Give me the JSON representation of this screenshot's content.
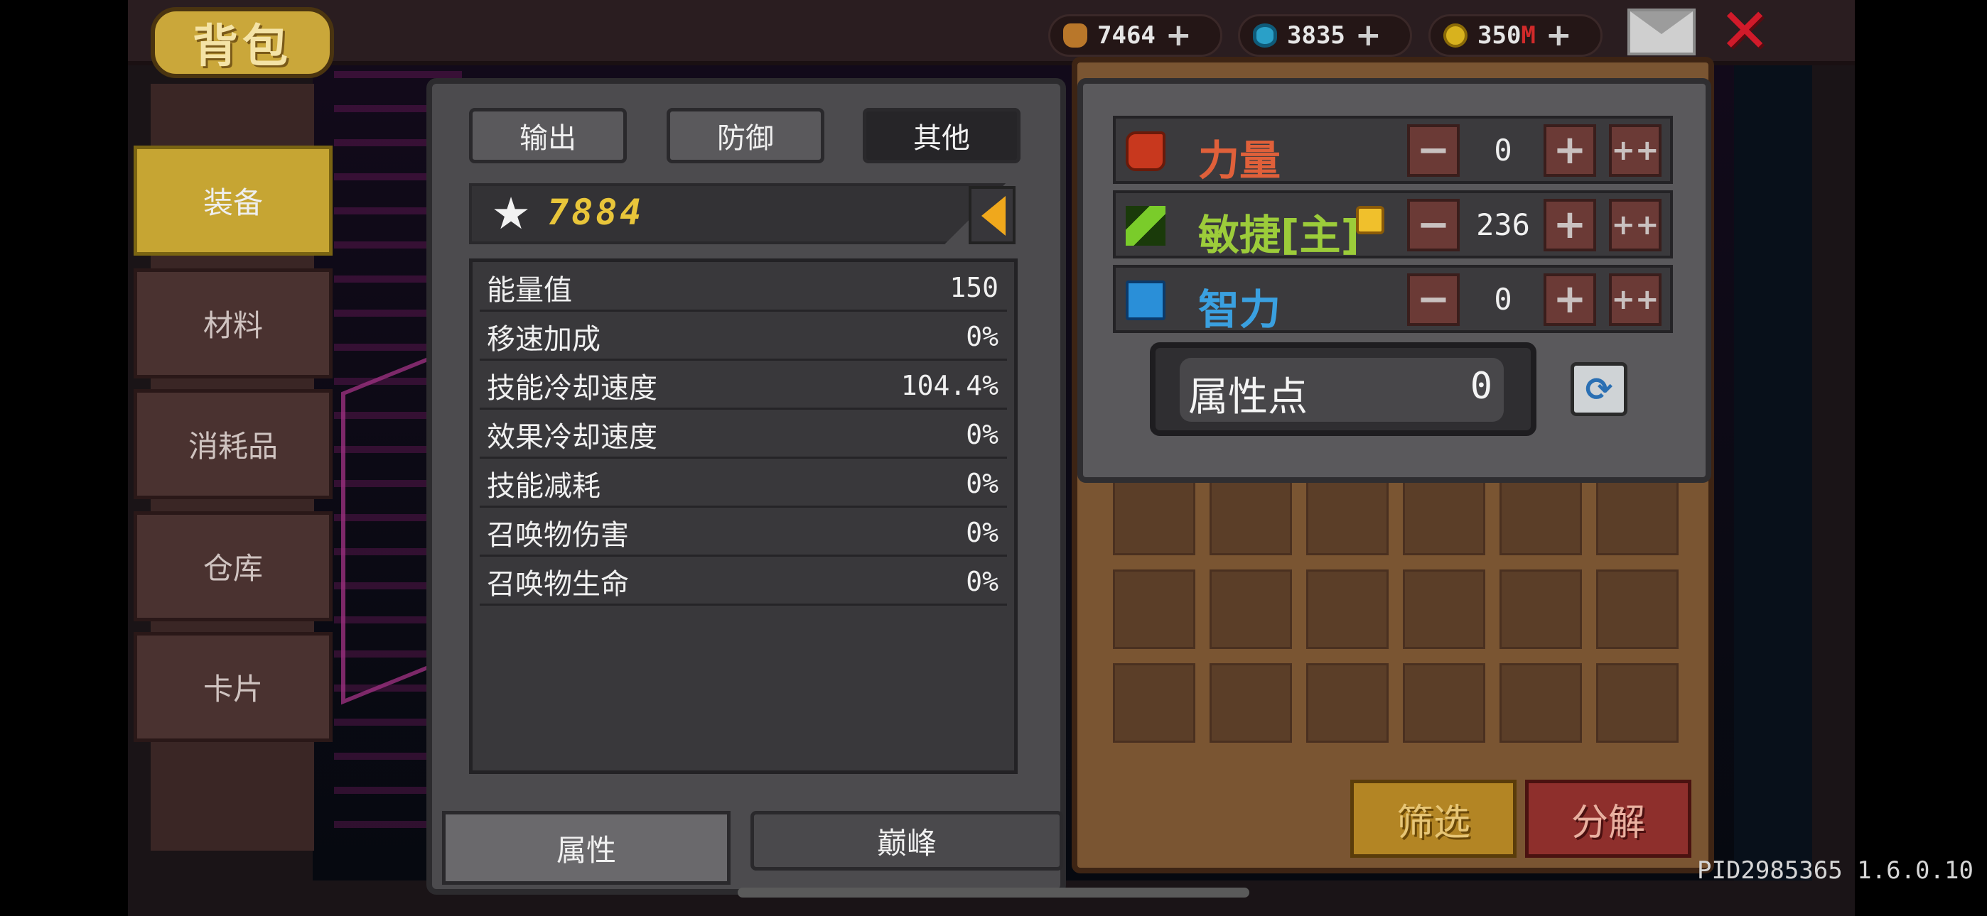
{
  "resources": [
    {
      "icon": "resource-bag-icon",
      "value": "7464",
      "plus": "+"
    },
    {
      "icon": "gem-icon",
      "value": "3835",
      "plus": "+"
    },
    {
      "icon": "gold-coin-icon",
      "value": "350",
      "suffix": "M",
      "plus": "+"
    }
  ],
  "header": {
    "title": "背包"
  },
  "left_tabs": [
    {
      "label": "装备",
      "active": true
    },
    {
      "label": "材料",
      "active": false
    },
    {
      "label": "消耗品",
      "active": false
    },
    {
      "label": "仓库",
      "active": false
    },
    {
      "label": "卡片",
      "active": false
    }
  ],
  "stat_tabs": [
    {
      "label": "输出",
      "active": false
    },
    {
      "label": "防御",
      "active": false
    },
    {
      "label": "其他",
      "active": true
    }
  ],
  "power": {
    "value": "7884"
  },
  "stats": [
    {
      "name": "能量值",
      "value": "150"
    },
    {
      "name": "移速加成",
      "value": "0%"
    },
    {
      "name": "技能冷却速度",
      "value": "104.4%"
    },
    {
      "name": "效果冷却速度",
      "value": "0%"
    },
    {
      "name": "技能减耗",
      "value": "0%"
    },
    {
      "name": "召唤物伤害",
      "value": "0%"
    },
    {
      "name": "召唤物生命",
      "value": "0%"
    }
  ],
  "bottom_tabs": [
    {
      "label": "属性",
      "active": true
    },
    {
      "label": "巅峰",
      "active": false
    }
  ],
  "attributes": [
    {
      "name": "力量",
      "value": "0",
      "color": "#e0603a"
    },
    {
      "name": "敏捷[主]",
      "value": "236",
      "color": "#9ccc3a"
    },
    {
      "name": "智力",
      "value": "0",
      "color": "#3aa0e0"
    }
  ],
  "attribute_buttons": {
    "minus": "−",
    "plus": "+",
    "plus_multi": "++"
  },
  "attribute_points": {
    "label": "属性点",
    "value": "0"
  },
  "inventory_buttons": {
    "filter": "筛选",
    "salvage": "分解"
  },
  "version": "PID2985365 1.6.0.10",
  "colors": {
    "gold_accent": "#e8c53a",
    "close_red": "#d11a2a"
  }
}
